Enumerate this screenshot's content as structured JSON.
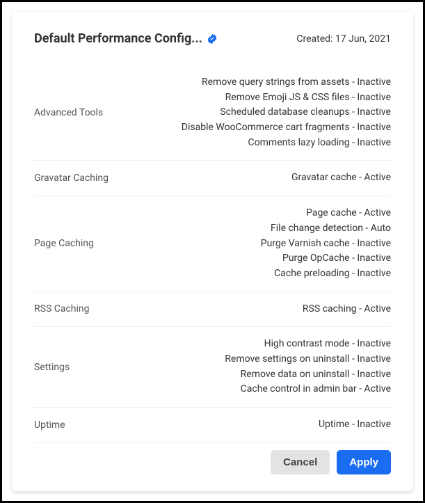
{
  "header": {
    "title": "Default Performance Config...",
    "created_label": "Created:",
    "created_date": "17 Jun, 2021"
  },
  "sections": [
    {
      "label": "Advanced Tools",
      "items": [
        {
          "name": "Remove query strings from assets",
          "status": "Inactive"
        },
        {
          "name": "Remove Emoji JS & CSS files",
          "status": "Inactive"
        },
        {
          "name": "Scheduled database cleanups",
          "status": "Inactive"
        },
        {
          "name": "Disable WooCommerce cart fragments",
          "status": "Inactive"
        },
        {
          "name": "Comments lazy loading",
          "status": "Inactive"
        }
      ]
    },
    {
      "label": "Gravatar Caching",
      "items": [
        {
          "name": "Gravatar cache",
          "status": "Active"
        }
      ]
    },
    {
      "label": "Page Caching",
      "items": [
        {
          "name": "Page cache",
          "status": "Active"
        },
        {
          "name": "File change detection",
          "status": "Auto"
        },
        {
          "name": "Purge Varnish cache",
          "status": "Inactive"
        },
        {
          "name": "Purge OpCache",
          "status": "Inactive"
        },
        {
          "name": "Cache preloading",
          "status": "Inactive"
        }
      ]
    },
    {
      "label": "RSS Caching",
      "items": [
        {
          "name": "RSS caching",
          "status": "Active"
        }
      ]
    },
    {
      "label": "Settings",
      "items": [
        {
          "name": "High contrast mode",
          "status": "Inactive"
        },
        {
          "name": "Remove settings on uninstall",
          "status": "Inactive"
        },
        {
          "name": "Remove data on uninstall",
          "status": "Inactive"
        },
        {
          "name": "Cache control in admin bar",
          "status": "Active"
        }
      ]
    },
    {
      "label": "Uptime",
      "items": [
        {
          "name": "Uptime",
          "status": "Inactive"
        }
      ]
    }
  ],
  "footer": {
    "cancel_label": "Cancel",
    "apply_label": "Apply"
  },
  "colors": {
    "accent": "#1a6cf0",
    "verified": "#1a6cf0"
  }
}
